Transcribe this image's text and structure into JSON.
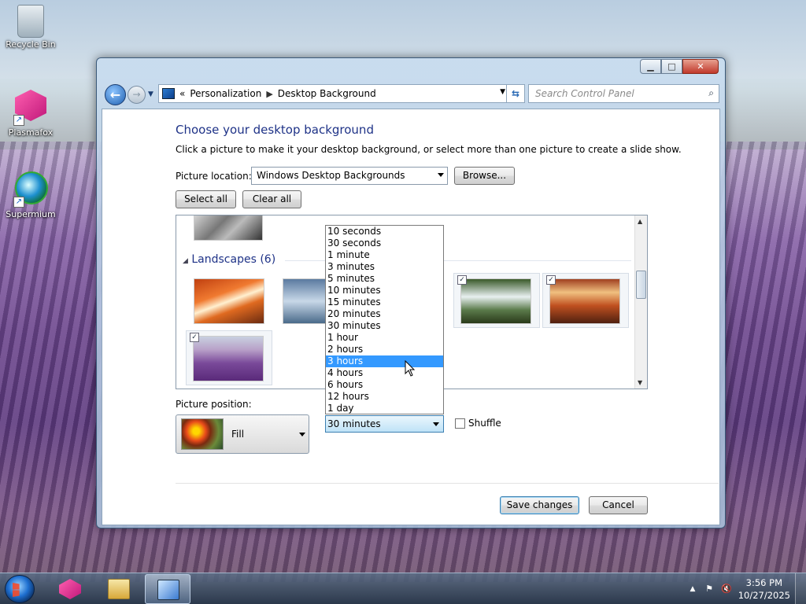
{
  "desktop": {
    "icons": [
      {
        "label": "Recycle Bin"
      },
      {
        "label": "Plasmafox"
      },
      {
        "label": "Supermium"
      }
    ]
  },
  "window": {
    "address": {
      "crumb1": "Personalization",
      "crumb2": "Desktop Background",
      "prefix": "«"
    },
    "search_placeholder": "Search Control Panel",
    "heading": "Choose your desktop background",
    "description": "Click a picture to make it your desktop background, or select more than one picture to create a slide show.",
    "picture_location_label": "Picture location:",
    "picture_location_value": "Windows Desktop Backgrounds",
    "browse_label": "Browse...",
    "select_all_label": "Select all",
    "clear_all_label": "Clear all",
    "group_header": "Landscapes (6)",
    "picture_position_label": "Picture position:",
    "picture_position_value": "Fill",
    "interval_options": [
      "10 seconds",
      "30 seconds",
      "1 minute",
      "3 minutes",
      "5 minutes",
      "10 minutes",
      "15 minutes",
      "20 minutes",
      "30 minutes",
      "1 hour",
      "2 hours",
      "3 hours",
      "4 hours",
      "6 hours",
      "12 hours",
      "1 day"
    ],
    "interval_highlighted": "3 hours",
    "interval_value": "30 minutes",
    "shuffle_label": "Shuffle",
    "save_label": "Save changes",
    "cancel_label": "Cancel"
  },
  "taskbar": {
    "time": "3:56 PM",
    "date": "10/27/2025"
  },
  "colors": {
    "heading": "#1e3287",
    "highlight": "#3399ff"
  }
}
